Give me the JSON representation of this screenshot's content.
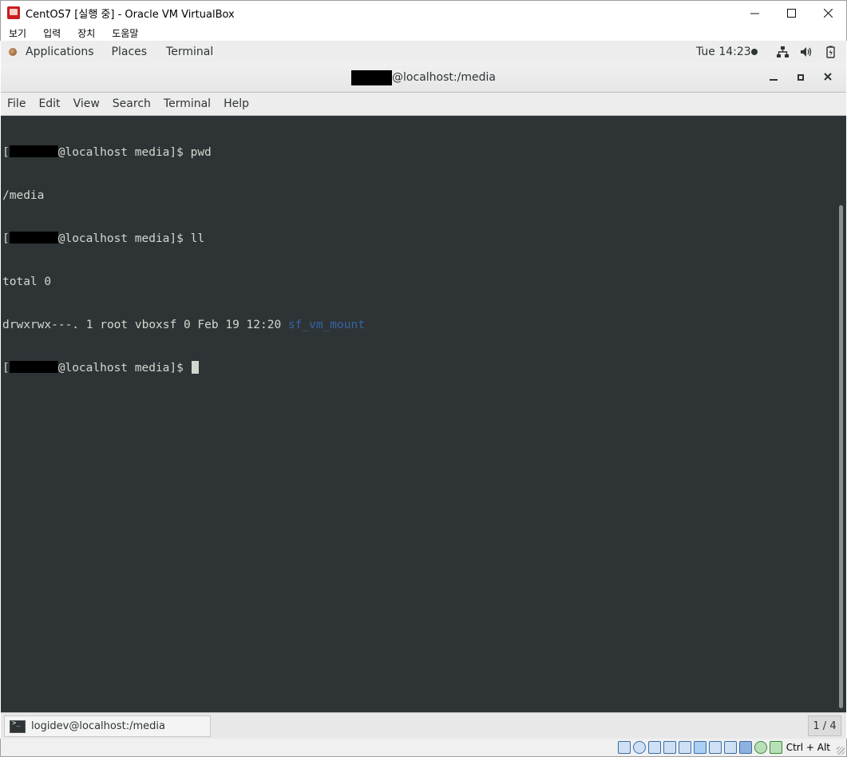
{
  "vbox": {
    "title": "CentOS7 [실행 중] - Oracle VM VirtualBox",
    "menu": [
      "보기",
      "입력",
      "장치",
      "도움말"
    ],
    "status_icons": [
      "hard-disk-icon",
      "optical-drive-icon",
      "audio-icon",
      "network-icon",
      "usb-icon",
      "shared-folders-icon",
      "display-icon",
      "video-capture-icon",
      "virtualization-icon",
      "mouse-integration-icon",
      "host-key-icon"
    ],
    "host_key": "Ctrl + Alt"
  },
  "gnome": {
    "applications": "Applications",
    "places": "Places",
    "terminal": "Terminal",
    "clock": "Tue 14:23",
    "tray_icons": [
      "network-icon",
      "volume-icon",
      "battery-icon"
    ],
    "taskbar_item": "logidev@localhost:/media",
    "workspace": "1 / 4"
  },
  "terminal": {
    "title": "@localhost:/media",
    "menu": [
      "File",
      "Edit",
      "View",
      "Search",
      "Terminal",
      "Help"
    ],
    "lines": [
      {
        "prefix": "[",
        "redacted": true,
        "rest": "@localhost media]$ pwd"
      },
      {
        "text": "/media"
      },
      {
        "prefix": "[",
        "redacted": true,
        "rest": "@localhost media]$ ll"
      },
      {
        "text": "total 0"
      },
      {
        "text": "drwxrwx---. 1 root vboxsf 0 Feb 19 12:20 ",
        "dir": "sf_vm_mount"
      },
      {
        "prefix": "[",
        "redacted": true,
        "rest": "@localhost media]$ ",
        "cursor": true
      }
    ]
  },
  "colors": {
    "terminal_bg": "#2e3436",
    "terminal_fg": "#d3d7cf",
    "directory_blue": "#3465a4"
  }
}
